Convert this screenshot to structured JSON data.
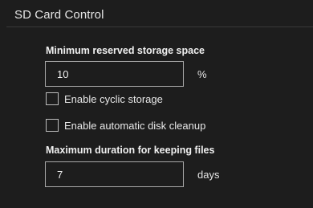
{
  "section": {
    "title": "SD Card Control"
  },
  "min_reserved": {
    "label": "Minimum reserved storage space",
    "value": "10",
    "unit": "%"
  },
  "cyclic_storage": {
    "label": "Enable cyclic storage",
    "checked": false
  },
  "auto_cleanup": {
    "label": "Enable automatic disk cleanup",
    "checked": false
  },
  "max_duration": {
    "label": "Maximum duration for keeping files",
    "value": "7",
    "unit": "days"
  }
}
